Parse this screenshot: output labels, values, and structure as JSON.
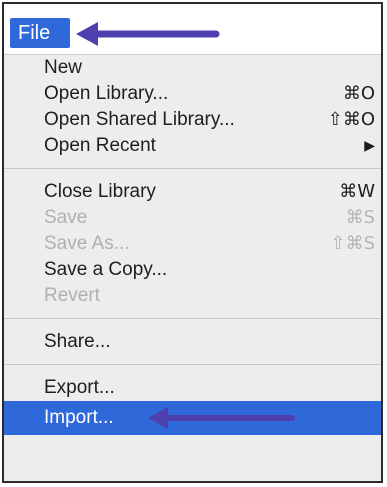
{
  "menu_title": "File",
  "colors": {
    "highlight": "#2f68d9",
    "arrow": "#4f40b0"
  },
  "items": [
    {
      "label": "New",
      "shortcut": "",
      "enabled": true
    },
    {
      "label": "Open Library...",
      "shortcut": "⌘O",
      "enabled": true
    },
    {
      "label": "Open Shared Library...",
      "shortcut": "⇧⌘O",
      "enabled": true
    },
    {
      "label": "Open Recent",
      "shortcut": "▶",
      "enabled": true
    },
    {
      "label": "Close Library",
      "shortcut": "⌘W",
      "enabled": true
    },
    {
      "label": "Save",
      "shortcut": "⌘S",
      "enabled": false
    },
    {
      "label": "Save As...",
      "shortcut": "⇧⌘S",
      "enabled": false
    },
    {
      "label": "Save a Copy...",
      "shortcut": "",
      "enabled": true
    },
    {
      "label": "Revert",
      "shortcut": "",
      "enabled": false
    },
    {
      "label": "Share...",
      "shortcut": "",
      "enabled": true
    },
    {
      "label": "Export...",
      "shortcut": "",
      "enabled": true
    },
    {
      "label": "Import...",
      "shortcut": "",
      "enabled": true,
      "highlighted": true
    }
  ],
  "icons": {
    "arrow_to_file": "left-arrow-icon",
    "arrow_to_import": "left-arrow-icon"
  }
}
